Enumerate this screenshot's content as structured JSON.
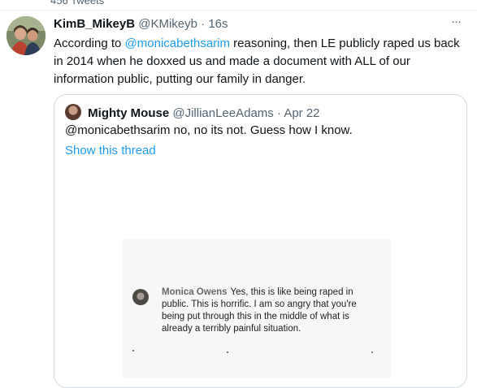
{
  "profile": {
    "tweet_count": "456 Tweets"
  },
  "tweet": {
    "display_name": "KimB_MikeyB",
    "handle": "@KMikeyb",
    "separator": "·",
    "time": "16s",
    "more_label": "···",
    "text_before_mention": "According to ",
    "mention": "@monicabethsarim",
    "text_after_mention": " reasoning, then LE publicly raped us back in 2014 when he doxxed us and made a document with ALL of our information public, putting our family in danger."
  },
  "quoted_tweet": {
    "display_name": "Mighty Mouse",
    "handle": "@JillianLeeAdams",
    "separator": "·",
    "date": "Apr 22",
    "text": "@monicabethsarim no, no its not. Guess how I know.",
    "show_thread_label": "Show this thread",
    "media": {
      "comment_author": "Monica Owens",
      "comment_text": "Yes, this is like being raped in public. This is horrific. I am so angry that you're being put through this in the middle of what is already a terribly painful situation."
    }
  },
  "colors": {
    "accent": "#1d9bf0",
    "text": "#0f1419",
    "secondary": "#536471",
    "border": "#cfd9de"
  }
}
